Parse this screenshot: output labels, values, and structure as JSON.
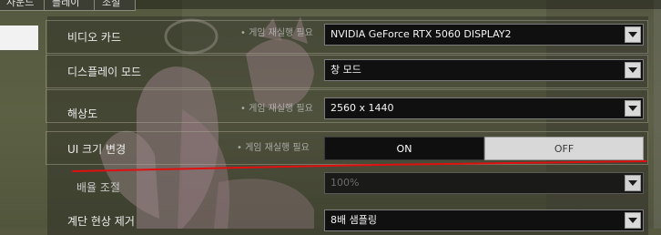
{
  "tabs": [
    {
      "label": "사운드"
    },
    {
      "label": "플레이"
    },
    {
      "label": "조절"
    }
  ],
  "settings": [
    {
      "label": "비디오 카드",
      "note": "• 게임 재실행 필요",
      "value": "NVIDIA GeForce RTX 5060 DISPLAY2"
    },
    {
      "label": "디스플레이 모드",
      "note": "",
      "value": "창 모드"
    },
    {
      "label": "해상도",
      "note": "• 게임 재실행 필요",
      "value": "2560 x 1440"
    },
    {
      "label": "UI 크기 변경",
      "note": "• 게임 재실행 필요",
      "on_label": "ON",
      "off_label": "OFF",
      "selected": "ON"
    },
    {
      "label": "배율 조절",
      "note": "",
      "value": "100%"
    },
    {
      "label": "계단 현상 제거",
      "note": "",
      "value": "8배 샘플링"
    }
  ],
  "colors": {
    "dropdown_bg": "#101010",
    "toggle_on_bg": "#0f0f0f",
    "toggle_off_bg": "#d8d8d8",
    "annotation_line": "#e01010"
  },
  "annotation": {
    "kind": "red-hand-drawn-line"
  }
}
